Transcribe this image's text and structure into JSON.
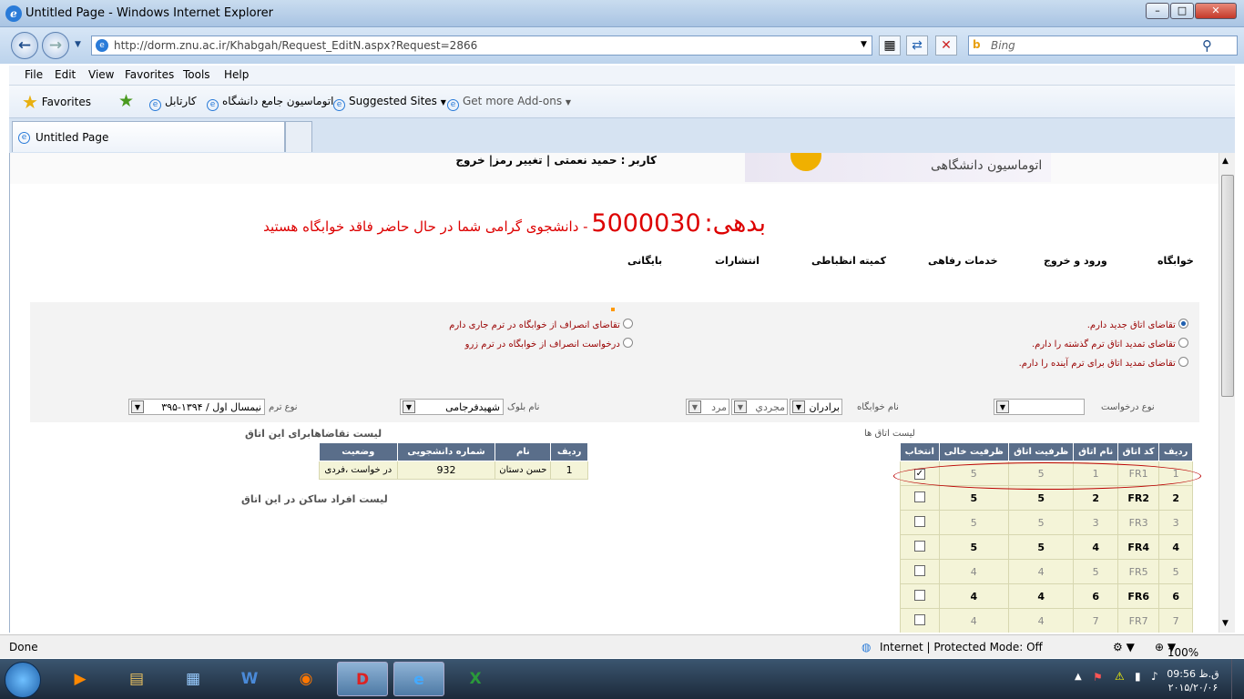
{
  "window": {
    "title": "Untitled Page - Windows Internet Explorer"
  },
  "address": {
    "url": "http://dorm.znu.ac.ir/Khabgah/Request_EditN.aspx?Request=2866",
    "search_placeholder": "Bing"
  },
  "menu": [
    "File",
    "Edit",
    "View",
    "Favorites",
    "Tools",
    "Help"
  ],
  "favorites": {
    "label": "Favorites",
    "links": [
      "کارتابل",
      "اتوماسیون جامع دانشگاه",
      "Suggested Sites",
      "Get more Add-ons"
    ]
  },
  "tab": {
    "title": "Untitled Page"
  },
  "page": {
    "user_line": "کاربر : حمید نعمتی | تغییر رمز| خروج",
    "logo_text": "اتوماسیون دانشگاهی",
    "debt_label": "بدهی:",
    "debt_amount": "5000030",
    "debt_message": "- دانشجوی گرامی شما در حال حاضر فاقد خوابگاه هستید",
    "nav": [
      "خوابگاه",
      "ورود و خروج",
      "خدمات رفاهی",
      "کمیته انظباطی",
      "انتشارات",
      "بایگانی"
    ],
    "options_right": [
      "تقاضای اتاق جدید دارم.",
      "تقاضای تمدید اتاق ترم گذشته را دارم.",
      "تقاضای تمدید اتاق برای ترم آینده را دارم."
    ],
    "options_left": [
      "تقاضای انصراف از خوابگاه در ترم جاری دارم",
      "درخواست انصراف از خوابگاه در ترم زرو"
    ],
    "filters": {
      "request_type_label": "نوع درخواست",
      "dorm_label": "نام خوابگاه",
      "dorm_value": "برادران",
      "dorm_type": "مجردي",
      "gender": "مرد",
      "block_label": "نام بلوک",
      "block_value": "شهیدفرجامی",
      "term_label": "نوع ترم",
      "term_value": "نیمسال اول / ۱۳۹۴-۳۹۵"
    },
    "rooms": {
      "title": "لیست اتاق ها",
      "headers": [
        "ردیف",
        "کد اتاق",
        "نام اتاق",
        "ظرفیت اتاق",
        "ظرفیت خالی",
        "انتخاب"
      ],
      "rows": [
        {
          "row": "1",
          "code": "FR1",
          "name": "1",
          "capacity": "5",
          "free": "5",
          "checked": true
        },
        {
          "row": "2",
          "code": "FR2",
          "name": "2",
          "capacity": "5",
          "free": "5",
          "checked": false
        },
        {
          "row": "3",
          "code": "FR3",
          "name": "3",
          "capacity": "5",
          "free": "5",
          "checked": false
        },
        {
          "row": "4",
          "code": "FR4",
          "name": "4",
          "capacity": "5",
          "free": "5",
          "checked": false
        },
        {
          "row": "5",
          "code": "FR5",
          "name": "5",
          "capacity": "4",
          "free": "4",
          "checked": false
        },
        {
          "row": "6",
          "code": "FR6",
          "name": "6",
          "capacity": "4",
          "free": "4",
          "checked": false
        },
        {
          "row": "7",
          "code": "FR7",
          "name": "7",
          "capacity": "4",
          "free": "4",
          "checked": false
        }
      ]
    },
    "requests": {
      "title": "لیست تقاضاهابرای این اتاق",
      "headers": [
        "ردیف",
        "نام",
        "شماره دانشجویی",
        "وضعیت"
      ],
      "rows": [
        {
          "row": "1",
          "name": "حسن دستان",
          "student_no": "932",
          "status": "در خواست ،فردی"
        }
      ]
    },
    "residents_title": "لیست افراد ساکن در این اتاق"
  },
  "status": {
    "left": "Done",
    "zone": "Internet | Protected Mode: Off",
    "zoom": "100%"
  },
  "clock": {
    "time": "09:56 ق.ظ",
    "date": "۲۰۱۵/۲۰/۰۶"
  }
}
